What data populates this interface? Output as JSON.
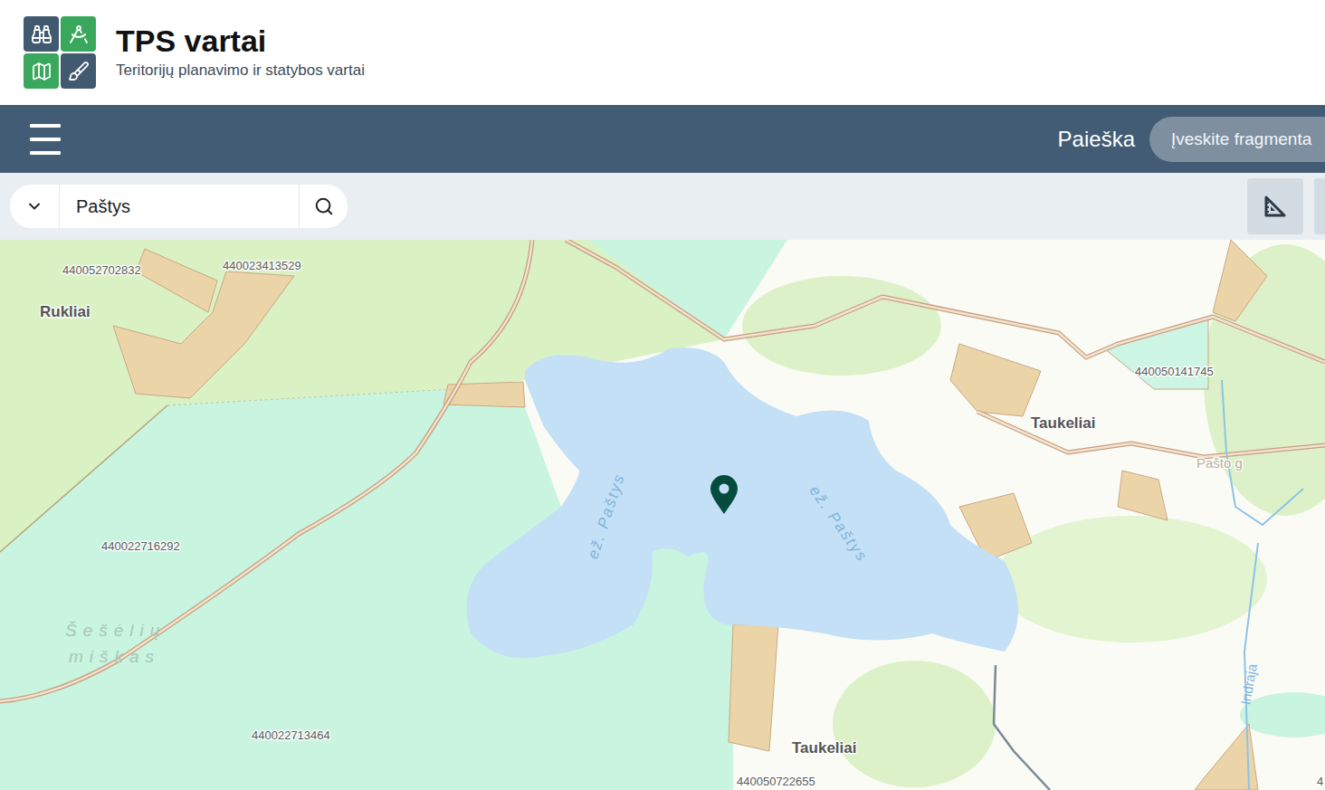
{
  "header": {
    "title": "TPS vartai",
    "subtitle": "Teritorijų planavimo ir statybos vartai"
  },
  "navbar": {
    "search_label": "Paieška",
    "search_placeholder": "Įveskite fragmenta"
  },
  "search": {
    "value": "Paštys"
  },
  "map": {
    "labels": [
      {
        "text": "440052702832",
        "kind": "parcel"
      },
      {
        "text": "440023413529",
        "kind": "parcel"
      },
      {
        "text": "440050141745",
        "kind": "parcel"
      },
      {
        "text": "440022716292",
        "kind": "parcel"
      },
      {
        "text": "440022713464",
        "kind": "parcel"
      },
      {
        "text": "440050722655",
        "kind": "parcel"
      },
      {
        "text": "4",
        "kind": "parcel"
      },
      {
        "text": "Rukliai",
        "kind": "place"
      },
      {
        "text": "Taukeliai",
        "kind": "place"
      },
      {
        "text": "Taukeliai",
        "kind": "place"
      },
      {
        "text": "ež. Paštys",
        "kind": "lake"
      },
      {
        "text": "ež. Paštys",
        "kind": "lake"
      },
      {
        "text": "Pašto g",
        "kind": "street"
      },
      {
        "text": "Indraja",
        "kind": "river"
      },
      {
        "text": "Šešėlių",
        "kind": "forest"
      },
      {
        "text": "miškas",
        "kind": "forest"
      }
    ]
  }
}
